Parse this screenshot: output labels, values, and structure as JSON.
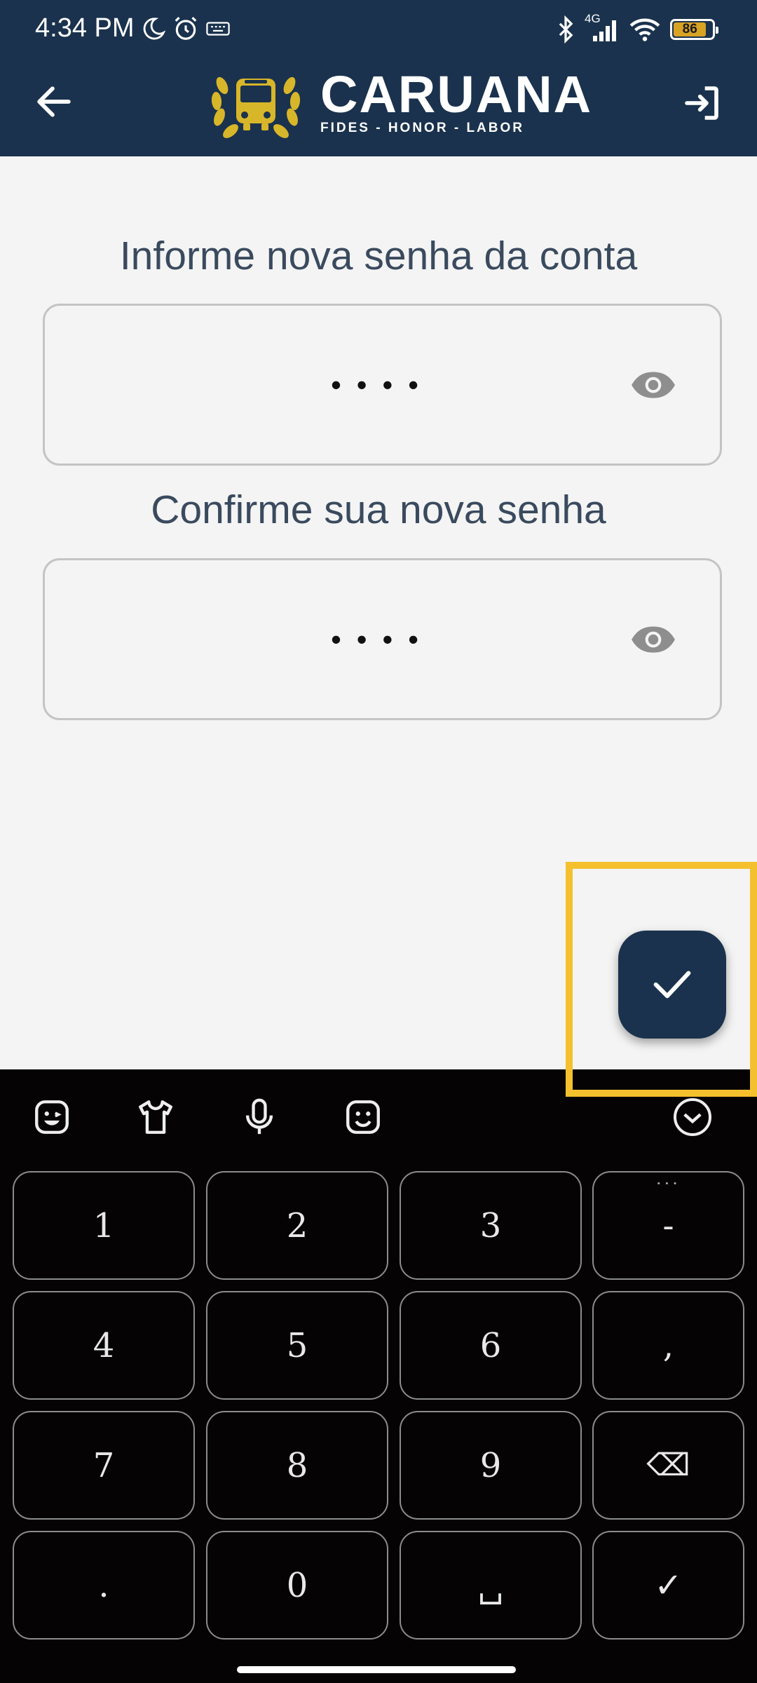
{
  "status_bar": {
    "time": "4:34 PM",
    "network": "4G",
    "battery": "86",
    "battery_level": 0.86
  },
  "header": {
    "brand_name": "CARUANA",
    "brand_motto": "FIDES - HONOR - LABOR",
    "back_icon": "arrow-left-icon",
    "logout_icon": "logout-icon"
  },
  "form": {
    "new_password_label": "Informe nova senha da conta",
    "new_password_value": "••••",
    "confirm_password_label": "Confirme sua nova senha",
    "confirm_password_value": "••••"
  },
  "keyboard": {
    "rows": [
      [
        "1",
        "2",
        "3",
        "-"
      ],
      [
        "4",
        "5",
        "6",
        ","
      ],
      [
        "7",
        "8",
        "9",
        "⌫"
      ],
      [
        ".",
        "0",
        "␣",
        "✓"
      ]
    ],
    "hint_dash": "···"
  },
  "colors": {
    "primary": "#1a324d",
    "highlight": "#f4c02e",
    "logo_gold": "#d8b62a"
  }
}
